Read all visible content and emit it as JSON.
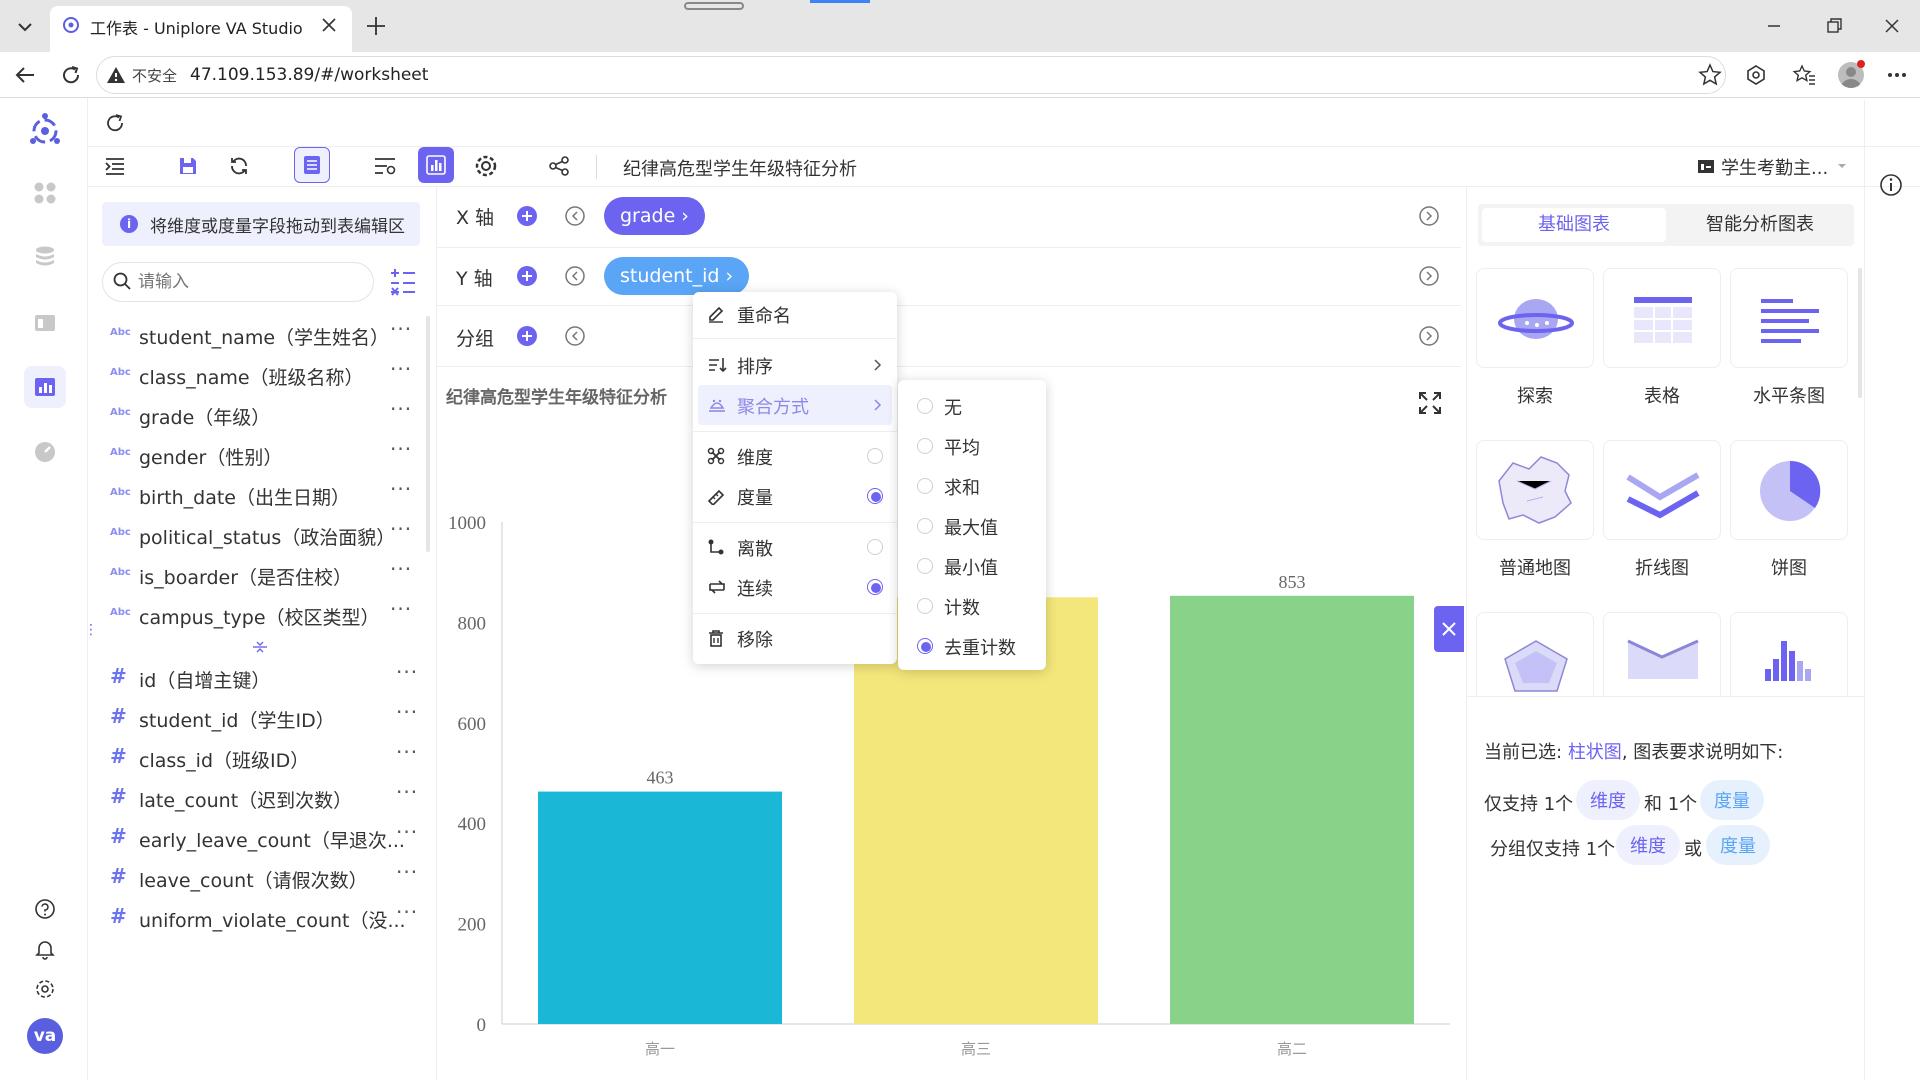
{
  "browser": {
    "tab_title": "工作表 - Uniplore VA Studio",
    "insecure_label": "不安全",
    "url": "47.109.153.89/#/worksheet"
  },
  "toolbar": {
    "sheet_title": "纪律高危型学生年级特征分析",
    "datasource_label": "学生考勤主...",
    "hint": "将维度或度量字段拖动到表编辑区"
  },
  "search": {
    "placeholder": "请输入"
  },
  "dimension_fields": [
    {
      "name": "student_name（学生姓名）"
    },
    {
      "name": "class_name（班级名称）"
    },
    {
      "name": "grade（年级）"
    },
    {
      "name": "gender（性别）"
    },
    {
      "name": "birth_date（出生日期）"
    },
    {
      "name": "political_status（政治面貌）"
    },
    {
      "name": "is_boarder（是否住校）"
    },
    {
      "name": "campus_type（校区类型）"
    }
  ],
  "measure_fields": [
    {
      "name": "id（自增主键）"
    },
    {
      "name": "student_id（学生ID）"
    },
    {
      "name": "class_id（班级ID）"
    },
    {
      "name": "late_count（迟到次数）"
    },
    {
      "name": "early_leave_count（早退次..."
    },
    {
      "name": "leave_count（请假次数）"
    },
    {
      "name": "uniform_violate_count（没..."
    }
  ],
  "field_badge": "Abc",
  "measure_badge": "#",
  "more_label": "···",
  "shelves": {
    "x_label": "X 轴",
    "y_label": "Y 轴",
    "group_label": "分组",
    "x_pill": "grade ›",
    "y_pill": "student_id ›"
  },
  "context_menu": {
    "rename": "重命名",
    "sort": "排序",
    "aggregate": "聚合方式",
    "dimension": "维度",
    "measure": "度量",
    "discrete": "离散",
    "continuous": "连续",
    "remove": "移除"
  },
  "aggregate_menu": [
    {
      "label": "无",
      "selected": false
    },
    {
      "label": "平均",
      "selected": false
    },
    {
      "label": "求和",
      "selected": false
    },
    {
      "label": "最大值",
      "selected": false
    },
    {
      "label": "最小值",
      "selected": false
    },
    {
      "label": "计数",
      "selected": false
    },
    {
      "label": "去重计数",
      "selected": true
    }
  ],
  "chart_panel": {
    "tab_basic": "基础图表",
    "tab_smart": "智能分析图表",
    "tiles": [
      "探索",
      "表格",
      "水平条图",
      "普通地图",
      "折线图",
      "饼图"
    ],
    "selected_prefix": "当前已选:",
    "selected_chart": "柱状图",
    "selected_suffix": ", 图表要求说明如下:",
    "req1_prefix": "仅支持 1个",
    "req1_and": "和 1个",
    "req2_prefix": "分组仅支持 1个",
    "req2_or": "或",
    "tag_dimension": "维度",
    "tag_measure": "度量"
  },
  "colors": {
    "accent": "#6c63f0",
    "y_pill": "#5aa5f5",
    "bar1": "#1ab8d6",
    "bar2": "#f3e67a",
    "bar3": "#88d28a"
  },
  "user_avatar": "va",
  "chart_data": {
    "type": "bar",
    "title": "纪律高危型学生年级特征分析",
    "categories": [
      "高一",
      "高三",
      "高二"
    ],
    "values": [
      463,
      850,
      853
    ],
    "data_labels": [
      "463",
      "",
      "853"
    ],
    "ylim": [
      0,
      1000
    ],
    "yticks": [
      0,
      200,
      400,
      600,
      800,
      1000
    ],
    "grid": false,
    "xlabel": "",
    "ylabel": ""
  }
}
